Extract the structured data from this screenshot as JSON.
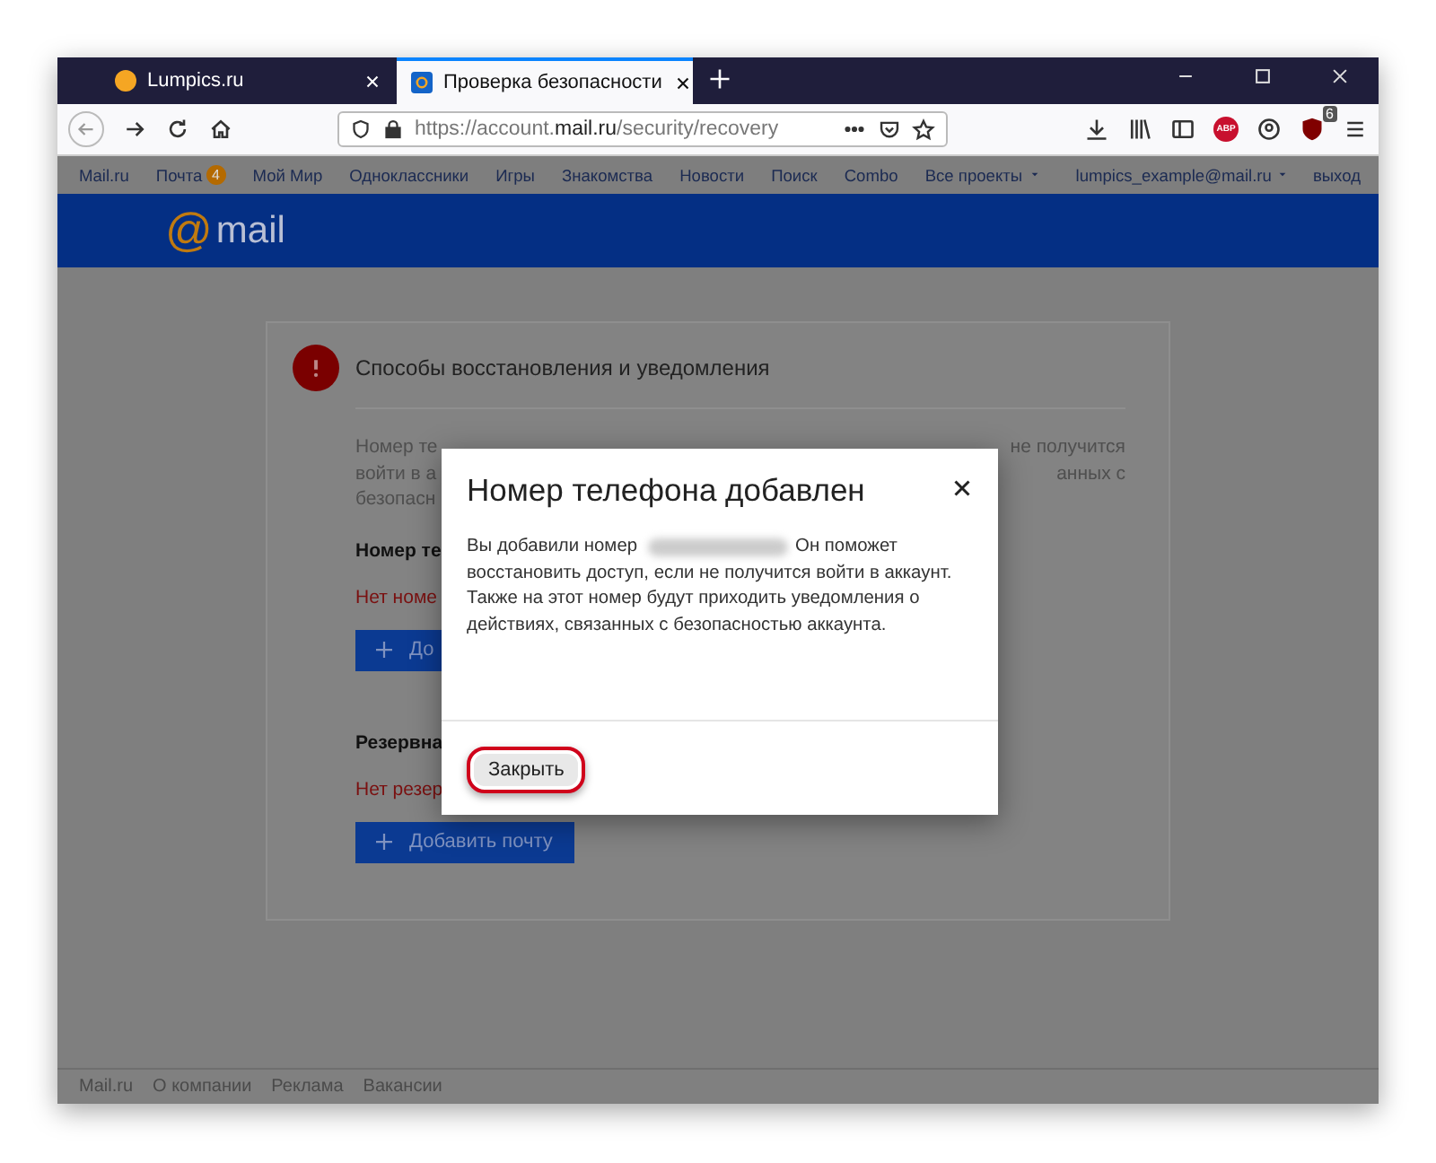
{
  "browser": {
    "tabs": [
      {
        "title": "Lumpics.ru",
        "selected": false
      },
      {
        "title": "Проверка безопасности",
        "selected": true
      }
    ],
    "url": {
      "prefix": "https://account.",
      "host": "mail.ru",
      "path": "/security/recovery"
    },
    "abp_label": "ABP",
    "ublock_badge": "6"
  },
  "portal_nav": {
    "items": [
      {
        "label": "Mail.ru",
        "dropdown": false
      },
      {
        "label": "Почта",
        "badge": "4",
        "dropdown": false
      },
      {
        "label": "Мой Мир",
        "dropdown": false
      },
      {
        "label": "Одноклассники",
        "dropdown": false
      },
      {
        "label": "Игры",
        "dropdown": false
      },
      {
        "label": "Знакомства",
        "dropdown": false
      },
      {
        "label": "Новости",
        "dropdown": false
      },
      {
        "label": "Поиск",
        "dropdown": false
      },
      {
        "label": "Combo",
        "dropdown": false
      },
      {
        "label": "Все проекты",
        "dropdown": true
      }
    ],
    "user": "lumpics_example@mail.ru",
    "logout": "выход"
  },
  "header": {
    "logo_symbol": "@",
    "logo_text": "mail"
  },
  "card": {
    "title": "Способы восстановления и уведомления",
    "description_lines": [
      {
        "left": "Номер те",
        "right": "не получится"
      },
      {
        "left": "войти в а",
        "right": "анных с"
      },
      {
        "left": "безопасн"
      }
    ],
    "sections": [
      {
        "heading": "Номер те",
        "status": "Нет номе",
        "button": "До"
      },
      {
        "heading": "Резервна",
        "status": "Нет резер",
        "button": "Добавить почту"
      }
    ]
  },
  "dialog": {
    "title": "Номер телефона добавлен",
    "text_before": "Вы добавили номер",
    "text_after": "Он поможет",
    "text_rest": "восстановить доступ, если не получится войти в аккаунт. Также на этот номер будут приходить уведомления о действиях, связанных с безопасностью аккаунта.",
    "close_button": "Закрыть"
  },
  "footer": {
    "links": [
      "Mail.ru",
      "О компании",
      "Реклама",
      "Вакансии"
    ]
  }
}
